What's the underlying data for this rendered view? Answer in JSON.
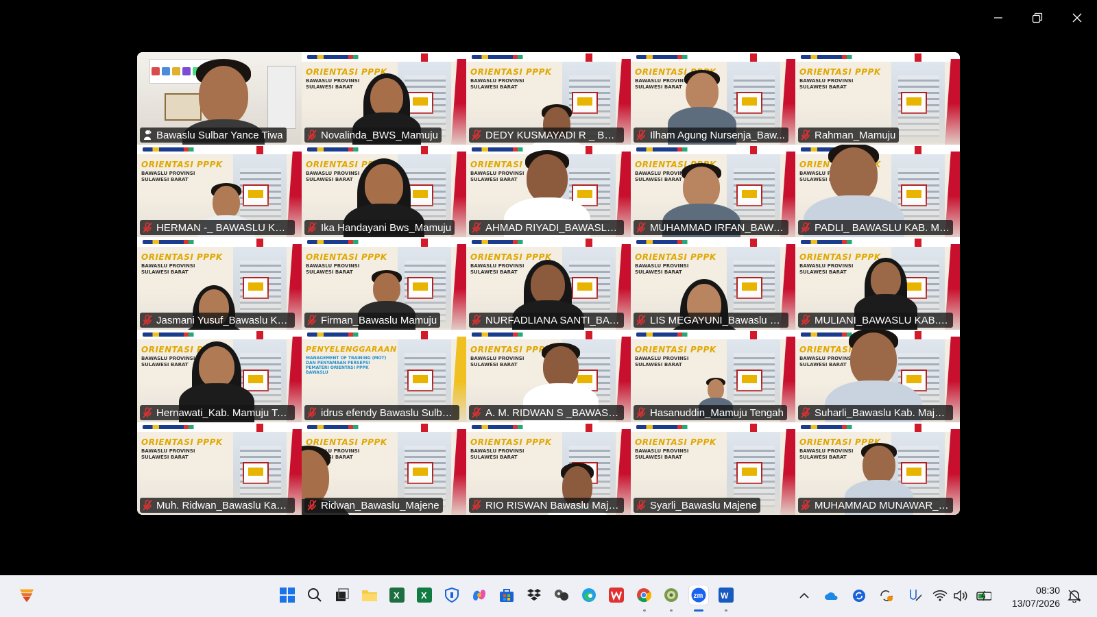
{
  "window": {
    "controls": [
      "minimize-icon",
      "restore-icon",
      "close-icon"
    ]
  },
  "slide": {
    "title": "ORIENTASI PPPK",
    "subtitle": "BAWASLU PROVINSI SULAWESI BARAT",
    "alt_title": "PENYELENGGARAAN",
    "alt_subtitle": "MANAGEMENT OF TRAINING (MOT) DAN PENYAMAAN PERSEPSI PEMATERI ORIENTASI PPPK BAWASLU"
  },
  "participants": [
    {
      "name": "Bawaslu Sulbar Yance Tiwa",
      "active": true,
      "host": true
    },
    {
      "name": "Novalinda_BWS_Mamuju"
    },
    {
      "name": "DEDY KUSMAYADI R _ BAW..."
    },
    {
      "name": "Ilham Agung Nursenja_Baw..."
    },
    {
      "name": "Rahman_Mamuju"
    },
    {
      "name": "HERMAN -_ BAWASLU KABU..."
    },
    {
      "name": "Ika Handayani Bws_Mamuju"
    },
    {
      "name": "AHMAD RIYADI_BAWASLU ..."
    },
    {
      "name": "MUHAMMAD IRFAN_BAWAS..."
    },
    {
      "name": "PADLI_ BAWASLU KAB. MAM..."
    },
    {
      "name": "Jasmani Yusuf_Bawaslu Kab...."
    },
    {
      "name": "Firman_Bawaslu Mamuju"
    },
    {
      "name": "NURFADLIANA SANTI_BAWA..."
    },
    {
      "name": "LIS MEGAYUNI_Bawaslu Kab..."
    },
    {
      "name": "MULIANI_BAWASLU KAB.MA..."
    },
    {
      "name": "Hernawati_Kab. Mamuju Ten..."
    },
    {
      "name": "idrus efendy Bawaslu Sulbar..."
    },
    {
      "name": "A. M. RIDWAN S _BAWASLU ..."
    },
    {
      "name": "Hasanuddin_Mamuju Tengah"
    },
    {
      "name": "Suharli_Bawaslu Kab. Majene"
    },
    {
      "name": "Muh. Ridwan_Bawaslu Kab. ..."
    },
    {
      "name": "Ridwan_Bawaslu_Majene"
    },
    {
      "name": "RIO RISWAN Bawaslu Majene"
    },
    {
      "name": "Syarli_Bawaslu Majene"
    },
    {
      "name": "MUHAMMAD MUNAWAR_B..."
    }
  ],
  "taskbar": {
    "apps": [
      "widgets-icon",
      "start-icon",
      "search-icon",
      "task-view-icon",
      "file-explorer-icon",
      "excel-icon",
      "excel-icon",
      "security-icon",
      "copilot-icon",
      "store-icon",
      "dropbox-icon",
      "app-icon",
      "edge-icon",
      "wps-icon",
      "chrome-icon",
      "app-icon",
      "zoom-icon",
      "word-icon"
    ],
    "time": "08:30",
    "date": "13/07/2026"
  }
}
